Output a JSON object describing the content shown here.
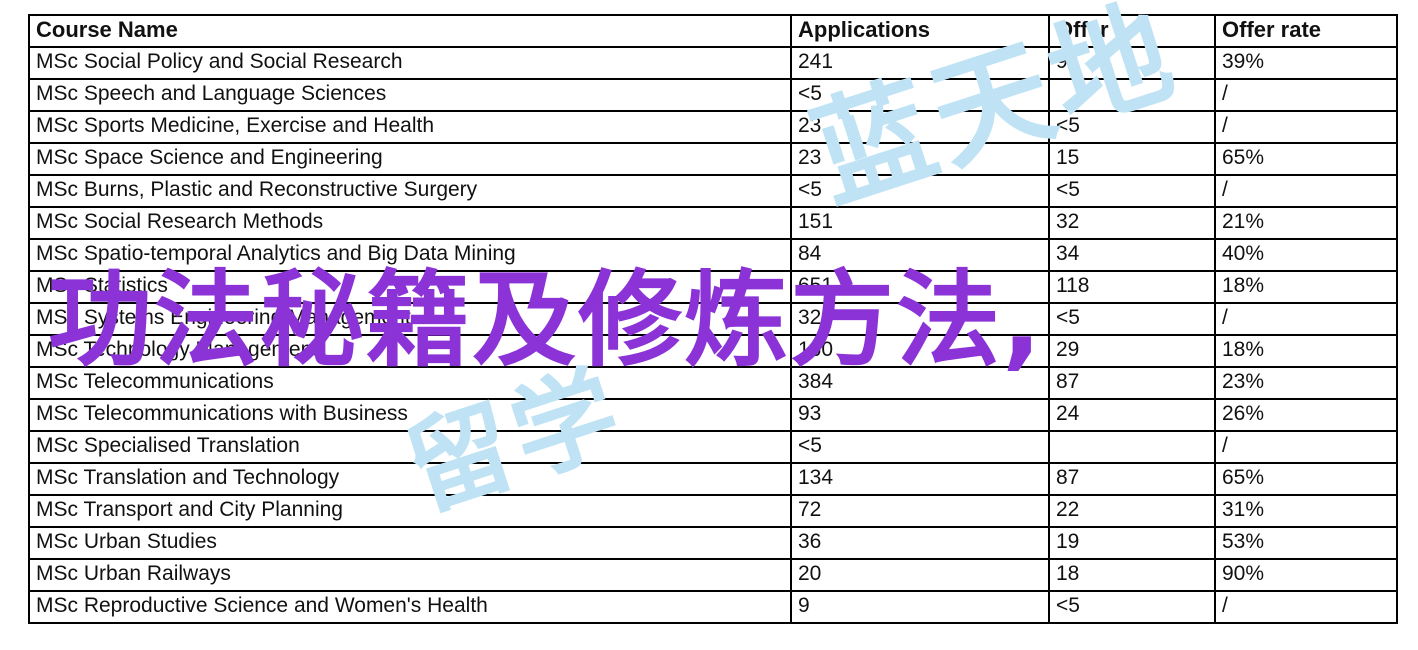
{
  "table": {
    "columns": [
      "Course Name",
      "Applications",
      "Offer",
      "Offer rate"
    ],
    "rows": [
      {
        "name": "MSc Social Policy and Social Research",
        "applications": "241",
        "offer": "95",
        "rate": "39%"
      },
      {
        "name": "MSc Speech and Language Sciences",
        "applications": "<5",
        "offer": "",
        "rate": "/"
      },
      {
        "name": "MSc Sports Medicine, Exercise and Health",
        "applications": "23",
        "offer": "<5",
        "rate": "/"
      },
      {
        "name": "MSc Space Science and Engineering",
        "applications": "23",
        "offer": "15",
        "rate": "65%"
      },
      {
        "name": "MSc Burns, Plastic and Reconstructive Surgery",
        "applications": "<5",
        "offer": "<5",
        "rate": "/"
      },
      {
        "name": "MSc Social Research Methods",
        "applications": "151",
        "offer": "32",
        "rate": "21%"
      },
      {
        "name": "MSc Spatio-temporal Analytics and Big Data Mining",
        "applications": "84",
        "offer": "34",
        "rate": "40%"
      },
      {
        "name": "MSc Statistics",
        "applications": "651",
        "offer": "118",
        "rate": "18%"
      },
      {
        "name": "MSc Systems Engineering Management",
        "applications": "32",
        "offer": "<5",
        "rate": "/"
      },
      {
        "name": "MSc Technology Management",
        "applications": "160",
        "offer": "29",
        "rate": "18%"
      },
      {
        "name": "MSc Telecommunications",
        "applications": "384",
        "offer": "87",
        "rate": "23%"
      },
      {
        "name": "MSc Telecommunications with Business",
        "applications": "93",
        "offer": "24",
        "rate": "26%"
      },
      {
        "name": "MSc Specialised Translation",
        "applications": "<5",
        "offer": "",
        "rate": "/"
      },
      {
        "name": "MSc Translation and Technology",
        "applications": "134",
        "offer": "87",
        "rate": "65%"
      },
      {
        "name": "MSc Transport and City Planning",
        "applications": "72",
        "offer": "22",
        "rate": "31%"
      },
      {
        "name": "MSc Urban Studies",
        "applications": "36",
        "offer": "19",
        "rate": "53%"
      },
      {
        "name": "MSc Urban Railways",
        "applications": "20",
        "offer": "18",
        "rate": "90%"
      },
      {
        "name": "MSc Reproductive Science and Women's Health",
        "applications": "9",
        "offer": "<5",
        "rate": "/"
      }
    ]
  },
  "watermarks": {
    "purple_text": "功法秘籍及修炼方法,",
    "purple_color": "#8b33d6",
    "blue_text_top": "蓝天地",
    "blue_text_bottom": "留学",
    "blue_color": "#bfe3f5"
  }
}
